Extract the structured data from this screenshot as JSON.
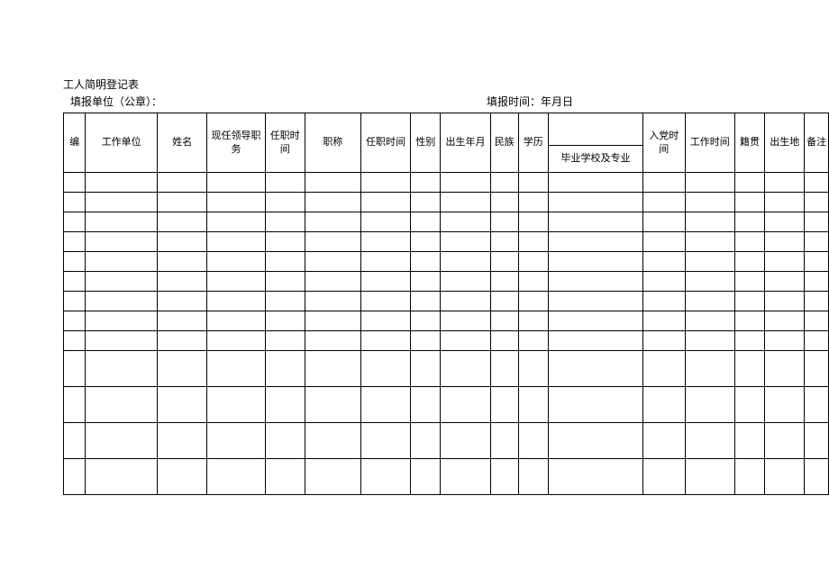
{
  "title": "工人简明登记表",
  "header": {
    "left": "填报单位（公章）：",
    "rightLabel": "填报时间：",
    "rightValue": "年月日"
  },
  "columns": {
    "c0": "编",
    "c1": "工作单位",
    "c2": "姓名",
    "c3": "现任领导职务",
    "c4": "任职时间",
    "c5": "职称",
    "c6": "任职时间",
    "c7": "性别",
    "c8": "出生年月",
    "c9": "民族",
    "c10": "学历",
    "c11_top": "",
    "c11_bottom": "毕业学校及专业",
    "c12": "入党时间",
    "c13": "工作时间",
    "c14": "籍贯",
    "c15": "出生地",
    "c16": "备注"
  }
}
